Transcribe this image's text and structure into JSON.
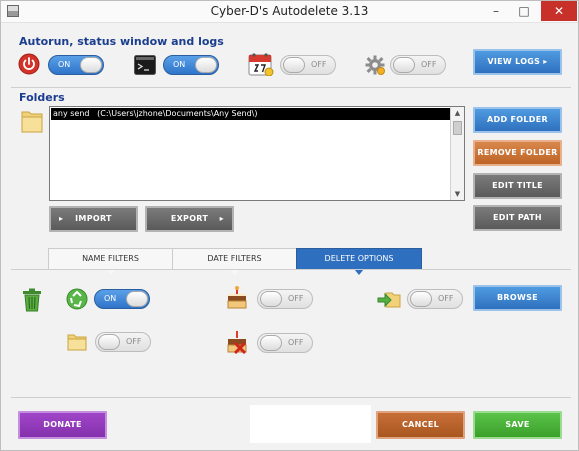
{
  "window": {
    "title": "Cyber-D's Autodelete 3.13",
    "minimize": "–",
    "maximize": "□",
    "close": "✕"
  },
  "autorun_section": {
    "title": "Autorun, status window and logs",
    "autorun_toggle": "ON",
    "status_toggle": "ON",
    "schedule_toggle": "OFF",
    "settings_toggle": "OFF",
    "view_logs": "VIEW LOGS  ▸"
  },
  "folders_section": {
    "title": "Folders",
    "entries": [
      "any send   (C:\\Users\\jzhone\\Documents\\Any Send\\)"
    ],
    "add_folder": "ADD FOLDER",
    "remove_folder": "REMOVE FOLDER",
    "edit_title": "EDIT TITLE",
    "edit_path": "EDIT PATH",
    "import": "IMPORT",
    "export": "EXPORT",
    "import_icon": "▸",
    "export_icon": "▸"
  },
  "tabs": [
    "NAME FILTERS",
    "DATE FILTERS",
    "DELETE OPTIONS"
  ],
  "active_tab": "DELETE OPTIONS",
  "delete_options": {
    "recycle_toggle": "ON",
    "cake_toggle": "OFF",
    "move_toggle": "OFF",
    "folder_toggle": "OFF",
    "delete_cake_toggle": "OFF",
    "browse": "BROWSE"
  },
  "footer": {
    "donate": "DONATE",
    "cancel": "CANCEL",
    "save": "SAVE"
  },
  "colors": {
    "accent": "#2f70be",
    "danger": "#c7312a",
    "success": "#3aa02a",
    "purple": "#8431ad",
    "orange": "#bd6527"
  }
}
